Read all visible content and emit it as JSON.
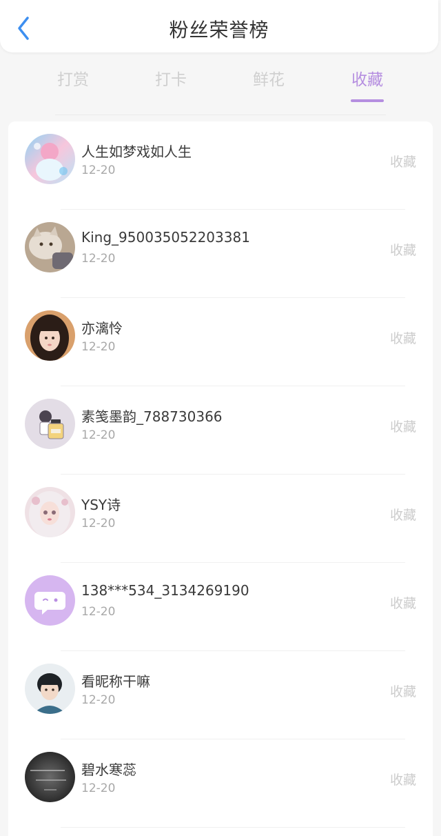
{
  "header": {
    "title": "粉丝荣誉榜",
    "back_icon": "chevron-left-icon",
    "accent_color": "#3d8ff0"
  },
  "tabs": {
    "items": [
      {
        "label": "打赏",
        "active": false
      },
      {
        "label": "打卡",
        "active": false
      },
      {
        "label": "鲜花",
        "active": false
      },
      {
        "label": "收藏",
        "active": true
      }
    ],
    "active_color": "#b58ee0",
    "inactive_color": "#cfcfcf"
  },
  "fans": [
    {
      "name": "人生如梦戏如人生",
      "date": "12-20",
      "action": "收藏",
      "avatar": "avatar-anime-girl-pastel"
    },
    {
      "name": "King_950035052203381",
      "date": "12-20",
      "action": "收藏",
      "avatar": "avatar-cat"
    },
    {
      "name": "亦漓怜",
      "date": "12-20",
      "action": "收藏",
      "avatar": "avatar-girl-dark-hair"
    },
    {
      "name": "素笺墨韵_788730366",
      "date": "12-20",
      "action": "收藏",
      "avatar": "avatar-perfume-illustration"
    },
    {
      "name": "YSY诗",
      "date": "12-20",
      "action": "收藏",
      "avatar": "avatar-doll"
    },
    {
      "name": "138***534_3134269190",
      "date": "12-20",
      "action": "收藏",
      "avatar": "avatar-chat-bubble-default"
    },
    {
      "name": "看昵称干嘛",
      "date": "12-20",
      "action": "收藏",
      "avatar": "avatar-boy-portrait"
    },
    {
      "name": "碧水寒蕊",
      "date": "12-20",
      "action": "收藏",
      "avatar": "avatar-grayscale-text"
    }
  ]
}
